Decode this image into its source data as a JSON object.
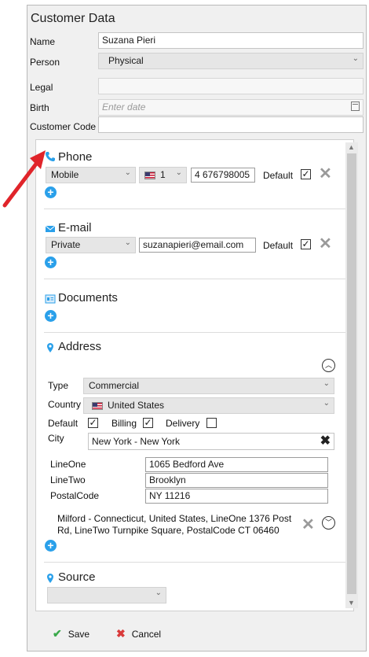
{
  "window": {
    "title": "Customer Data"
  },
  "form": {
    "name_label": "Name",
    "name_value": "Suzana Pieri",
    "person_label": "Person",
    "person_value": "Physical",
    "legal_label": "Legal",
    "birth_label": "Birth",
    "birth_placeholder": "Enter date",
    "code_label": "Customer Code"
  },
  "phone": {
    "title": "Phone",
    "type": "Mobile",
    "country_code": "1",
    "number": "4 676798005",
    "default_label": "Default"
  },
  "email": {
    "title": "E-mail",
    "type": "Private",
    "address": "suzanapieri@email.com",
    "default_label": "Default"
  },
  "documents": {
    "title": "Documents"
  },
  "address": {
    "title": "Address",
    "type_label": "Type",
    "type_value": "Commercial",
    "country_label": "Country",
    "country_value": "United States",
    "default_label": "Default",
    "billing_label": "Billing",
    "delivery_label": "Delivery",
    "city_label": "City",
    "city_value": "New York - New York",
    "lineone_label": "LineOne",
    "lineone_value": "1065 Bedford Ave",
    "linetwo_label": "LineTwo",
    "linetwo_value": "Brooklyn",
    "postal_label": "PostalCode",
    "postal_value": "NY 11216",
    "other_line1": "Milford - Connecticut, United States, LineOne 1376 Post",
    "other_line2": "Rd, LineTwo Turnpike Square, PostalCode CT 06460"
  },
  "source": {
    "title": "Source"
  },
  "footer": {
    "save": "Save",
    "cancel": "Cancel"
  },
  "colors": {
    "accent": "#2aa0ea",
    "arrow": "#e0242a",
    "save_check": "#3aa84a",
    "cancel_x": "#d93a3a"
  }
}
